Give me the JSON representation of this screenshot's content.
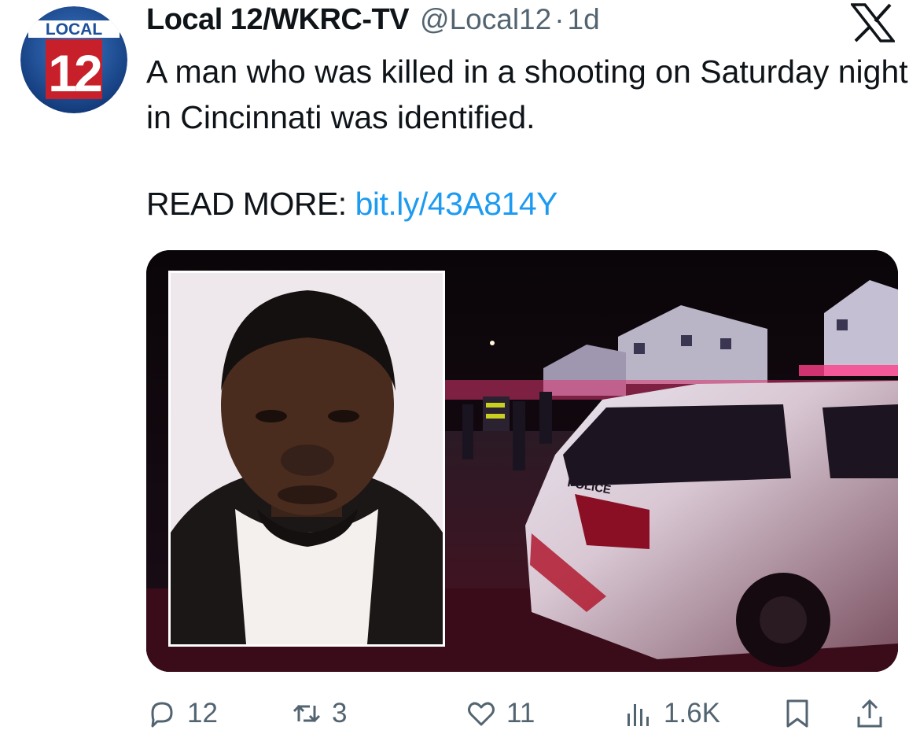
{
  "account": {
    "logo_top_text": "LOCAL",
    "logo_number": "12",
    "display_name": "Local 12/WKRC-TV",
    "handle": "@Local12",
    "separator": "·",
    "time": "1d"
  },
  "tweet": {
    "text": "A man who was killed in a shooting on Saturday night in Cincinnati was identified.",
    "read_more_label": "READ MORE: ",
    "link_text": "bit.ly/43A814Y"
  },
  "media": {
    "vehicle_text": "POLICE"
  },
  "actions": {
    "replies": "12",
    "reposts": "3",
    "likes": "11",
    "views": "1.6K"
  },
  "icons": {
    "platform": "x-logo-icon",
    "reply": "reply-icon",
    "repost": "repost-icon",
    "like": "heart-icon",
    "views": "views-bar-chart-icon",
    "bookmark": "bookmark-icon",
    "share": "share-icon"
  },
  "colors": {
    "link": "#1d9bf0",
    "secondary_text": "#536471",
    "logo_blue": "#1c4f9c",
    "logo_red": "#c8202a"
  }
}
